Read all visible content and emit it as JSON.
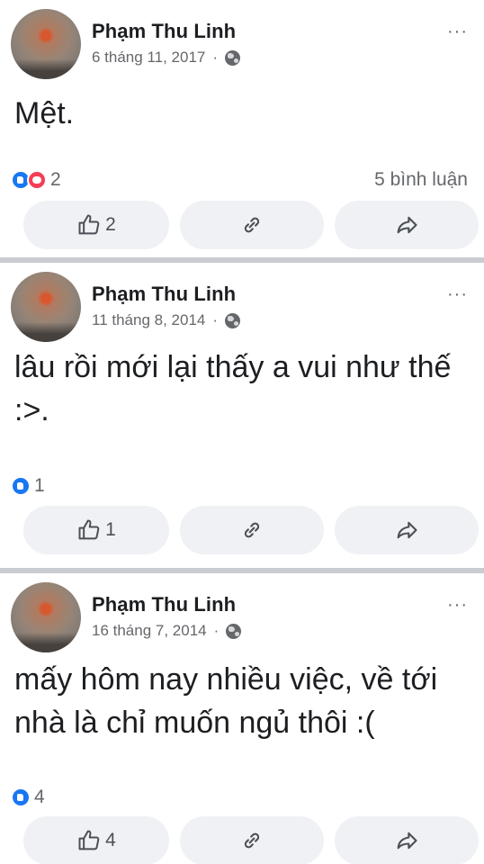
{
  "posts": [
    {
      "author": "Phạm Thu Linh",
      "date": "6 tháng 11, 2017",
      "meta_dot": "·",
      "text": "Mệt.",
      "reaction_count": "2",
      "reaction_types": [
        "like",
        "love"
      ],
      "comments": "5 bình luận",
      "like_count": "2"
    },
    {
      "author": "Phạm Thu Linh",
      "date": "11 tháng 8, 2014",
      "meta_dot": "·",
      "text": "lâu rồi mới lại thấy a vui như thế :>.",
      "reaction_count": "1",
      "reaction_types": [
        "like"
      ],
      "comments": "",
      "like_count": "1"
    },
    {
      "author": "Phạm Thu Linh",
      "date": "16 tháng 7, 2014",
      "meta_dot": "·",
      "text": "mấy hôm nay nhiều việc, về tới nhà là chỉ muốn ngủ thôi :(",
      "reaction_count": "4",
      "reaction_types": [
        "like"
      ],
      "comments": "",
      "like_count": "4"
    }
  ],
  "more_icon": "···",
  "colors": {
    "like_blue": "#1877f2",
    "love_red": "#f33e58",
    "separator": "#c9ccd1",
    "button_bg": "#eff1f4",
    "secondary_text": "#65676b"
  },
  "icons": [
    "avatar",
    "globe-icon",
    "more-icon",
    "like-icon",
    "love-icon",
    "thumbs-up-icon",
    "link-icon",
    "share-icon"
  ]
}
